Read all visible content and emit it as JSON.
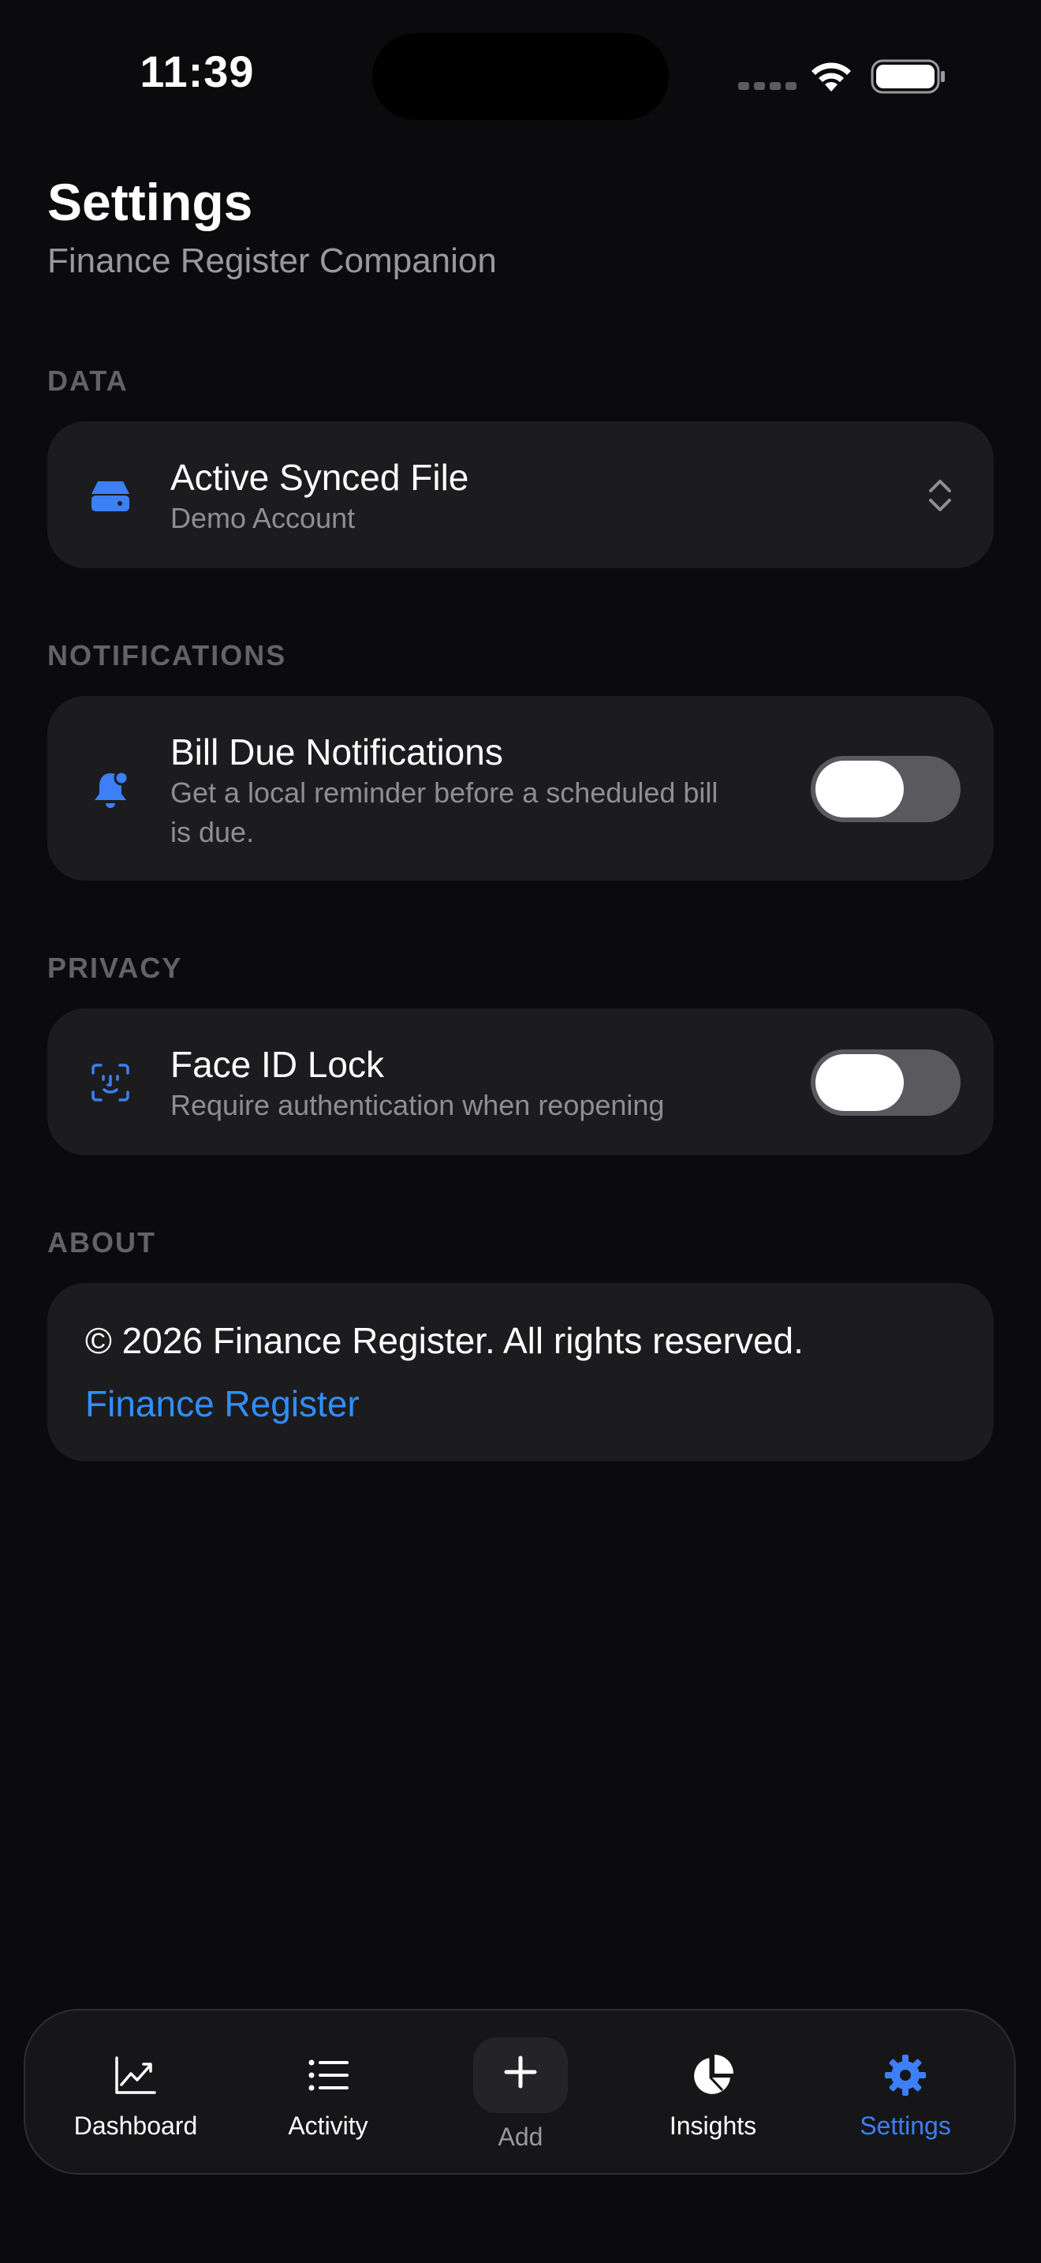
{
  "status_bar": {
    "time": "11:39"
  },
  "header": {
    "title": "Settings",
    "subtitle": "Finance Register Companion"
  },
  "sections": {
    "data": {
      "header": "DATA",
      "row": {
        "icon": "drive-icon",
        "title": "Active Synced File",
        "subtitle": "Demo Account"
      }
    },
    "notifications": {
      "header": "NOTIFICATIONS",
      "row": {
        "icon": "bell-badge-icon",
        "title": "Bill Due Notifications",
        "subtitle_line1": "Get a local reminder before a scheduled bill",
        "subtitle_line2": "is due.",
        "toggle_on": false
      }
    },
    "privacy": {
      "header": "PRIVACY",
      "row": {
        "icon": "face-id-icon",
        "title": "Face ID Lock",
        "subtitle": "Require authentication when reopening",
        "toggle_on": false
      }
    },
    "about": {
      "header": "ABOUT",
      "copyright": "© 2026 Finance Register. All rights reserved.",
      "link": "Finance Register"
    }
  },
  "tab_bar": {
    "tabs": [
      {
        "label": "Dashboard",
        "icon": "chart-line-icon"
      },
      {
        "label": "Activity",
        "icon": "list-icon"
      },
      {
        "label": "Add",
        "icon": "plus-icon"
      },
      {
        "label": "Insights",
        "icon": "pie-chart-icon"
      },
      {
        "label": "Settings",
        "icon": "gear-icon"
      }
    ],
    "active": "Settings"
  },
  "colors": {
    "accent": "#3d7ff5",
    "link": "#2f8fff",
    "background": "#0b0b0d",
    "card": "#1c1c1e"
  }
}
